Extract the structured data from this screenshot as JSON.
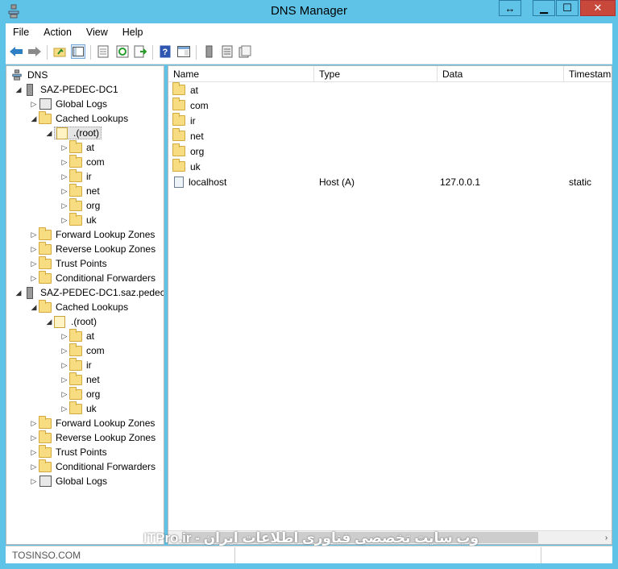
{
  "window": {
    "title": "DNS Manager"
  },
  "menu": {
    "file": "File",
    "action": "Action",
    "view": "View",
    "help": "Help"
  },
  "tree": {
    "dns": "DNS",
    "server1": {
      "name": "SAZ-PEDEC-DC1",
      "global_logs": "Global Logs",
      "cached_lookups": "Cached Lookups",
      "root": ".(root)",
      "domains": [
        "at",
        "com",
        "ir",
        "net",
        "org",
        "uk"
      ],
      "forward": "Forward Lookup Zones",
      "reverse": "Reverse Lookup Zones",
      "trust": "Trust Points",
      "conditional": "Conditional Forwarders"
    },
    "server2": {
      "name": "SAZ-PEDEC-DC1.saz.pedec",
      "cached_lookups": "Cached Lookups",
      "root": ".(root)",
      "domains": [
        "at",
        "com",
        "ir",
        "net",
        "org",
        "uk"
      ],
      "forward": "Forward Lookup Zones",
      "reverse": "Reverse Lookup Zones",
      "trust": "Trust Points",
      "conditional": "Conditional Forwarders",
      "global_logs": "Global Logs"
    }
  },
  "list": {
    "columns": {
      "name": "Name",
      "type": "Type",
      "data": "Data",
      "timestamp": "Timestam"
    },
    "rows": [
      {
        "name": "at",
        "type": "",
        "data": "",
        "timestamp": ""
      },
      {
        "name": "com",
        "type": "",
        "data": "",
        "timestamp": ""
      },
      {
        "name": "ir",
        "type": "",
        "data": "",
        "timestamp": ""
      },
      {
        "name": "net",
        "type": "",
        "data": "",
        "timestamp": ""
      },
      {
        "name": "org",
        "type": "",
        "data": "",
        "timestamp": ""
      },
      {
        "name": "uk",
        "type": "",
        "data": "",
        "timestamp": ""
      },
      {
        "name": "localhost",
        "type": "Host (A)",
        "data": "127.0.0.1",
        "timestamp": "static"
      }
    ]
  },
  "watermark": "وب سایت تخصصی فناوری اطلاعات ایران - ITPro.ir",
  "status": {
    "left": "TOSINSO.COM"
  },
  "colors": {
    "titlebar": "#5fc3e8",
    "close": "#c9483c",
    "folder": "#f8dc82"
  }
}
